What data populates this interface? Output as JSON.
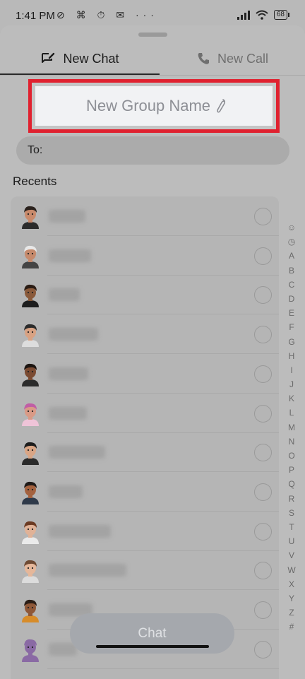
{
  "status_bar": {
    "time": "1:41 PM",
    "left_icons": "⊘ ⌘ ⏱ ✉ ···",
    "battery": "68"
  },
  "tabs": {
    "new_chat": "New Chat",
    "new_call": "New Call"
  },
  "group_name": {
    "placeholder": "New Group Name"
  },
  "to_field": {
    "label": "To:"
  },
  "recents": {
    "label": "Recents"
  },
  "contacts": [
    {
      "avatar_colors": {
        "skin": "#c98a6b",
        "hair": "#2a211c",
        "shirt": "#2b2b2b"
      }
    },
    {
      "avatar_colors": {
        "skin": "#c68a6c",
        "hair": "#e8e8e8",
        "shirt": "#444"
      }
    },
    {
      "avatar_colors": {
        "skin": "#8a5a3b",
        "hair": "#2a1c14",
        "shirt": "#1e1e1e"
      }
    },
    {
      "avatar_colors": {
        "skin": "#d8a283",
        "hair": "#2b2b2b",
        "shirt": "#dddddd"
      }
    },
    {
      "avatar_colors": {
        "skin": "#7b4b32",
        "hair": "#1b1410",
        "shirt": "#2c2c2c"
      }
    },
    {
      "avatar_colors": {
        "skin": "#d99a86",
        "hair": "#c05ea5",
        "shirt": "#efc4d8"
      }
    },
    {
      "avatar_colors": {
        "skin": "#d9a585",
        "hair": "#1d1d1d",
        "shirt": "#2a2a2a"
      }
    },
    {
      "avatar_colors": {
        "skin": "#a4623f",
        "hair": "#1f1a18",
        "shirt": "#2f3a4a"
      }
    },
    {
      "avatar_colors": {
        "skin": "#e0b297",
        "hair": "#6b3a22",
        "shirt": "#eaeaea"
      }
    },
    {
      "avatar_colors": {
        "skin": "#e5b79a",
        "hair": "#6e4a33",
        "shirt": "#dcdcdc"
      }
    },
    {
      "avatar_colors": {
        "skin": "#8f5838",
        "hair": "#2a1d16",
        "shirt": "#d78c2a"
      }
    },
    {
      "avatar_colors": {
        "skin": "#8a6aa4",
        "hair": "#8a6aa4",
        "shirt": "#8a6aa4"
      }
    }
  ],
  "alphabet_index": [
    "☺",
    "◷",
    "A",
    "B",
    "C",
    "D",
    "E",
    "F",
    "G",
    "H",
    "I",
    "J",
    "K",
    "L",
    "M",
    "N",
    "O",
    "P",
    "Q",
    "R",
    "S",
    "T",
    "U",
    "V",
    "W",
    "X",
    "Y",
    "Z",
    "#"
  ],
  "chat_button": {
    "label": "Chat"
  },
  "colors": {
    "highlight_border": "#e0212f",
    "sheet_bg": "#bcbcbc",
    "button_bg": "#a5a8ad"
  }
}
